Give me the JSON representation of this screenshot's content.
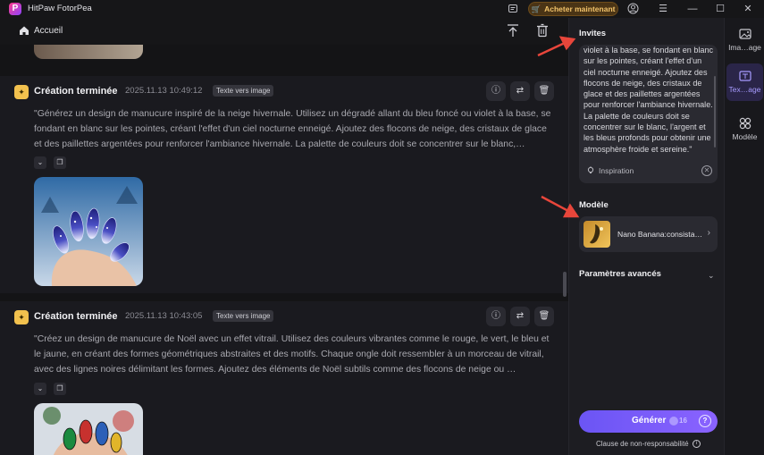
{
  "app": {
    "title": "HitPaw FotorPea",
    "logo_letter": "P",
    "buy_label": "Acheter maintenant"
  },
  "header": {
    "home_label": "Accueil"
  },
  "cards": [
    {
      "title": "Création terminée",
      "timestamp": "2025.11.13  10:49:12",
      "tag": "Texte vers image",
      "prompt": "\"Générez un design de manucure inspiré de la neige hivernale. Utilisez un dégradé allant du bleu foncé ou violet à la base, se fondant en blanc sur les pointes, créant l'effet d'un ciel nocturne enneigé. Ajoutez des flocons de neige, des cristaux de glace et des paillettes argentées pour renforcer l'ambiance hivernale. La palette de couleurs doit se concentrer sur le blanc,…"
    },
    {
      "title": "Création terminée",
      "timestamp": "2025.11.13  10:43:05",
      "tag": "Texte vers image",
      "prompt": "\"Créez un design de manucure de Noël avec un effet vitrail. Utilisez des couleurs vibrantes comme le rouge, le vert, le bleu et le jaune, en créant des formes géométriques abstraites et des motifs. Chaque ongle doit ressembler à un morceau de vitrail, avec des lignes noires délimitant les formes. Ajoutez des éléments de Noël subtils comme des flocons de neige ou …"
    }
  ],
  "panel": {
    "prompts_label": "Invites",
    "prompt_text": "violet à la base, se fondant en blanc sur les pointes, créant l'effet d'un ciel nocturne enneigé. Ajoutez des flocons de neige, des cristaux de glace et des paillettes argentées pour renforcer l'ambiance hivernale. La palette de couleurs doit se concentrer sur le blanc, l'argent et les bleus profonds pour obtenir une atmosphère froide et sereine.\"",
    "inspiration_label": "Inspiration",
    "model_label": "Modèle",
    "model_name": "Nano Banana:consista…",
    "advanced_label": "Paramètres avancés",
    "generate_label": "Générer",
    "generate_cost": "16",
    "disclaimer": "Clause de non-responsabilité"
  },
  "rail": [
    {
      "label": "Ima…age",
      "active": false
    },
    {
      "label": "Tex…age",
      "active": true
    },
    {
      "label": "Modèle",
      "active": false
    }
  ],
  "colors": {
    "accent": "#7b5cff",
    "badge": "#f2c14e",
    "buy": "#f3c46b",
    "annotation_arrow": "#e8463b"
  }
}
